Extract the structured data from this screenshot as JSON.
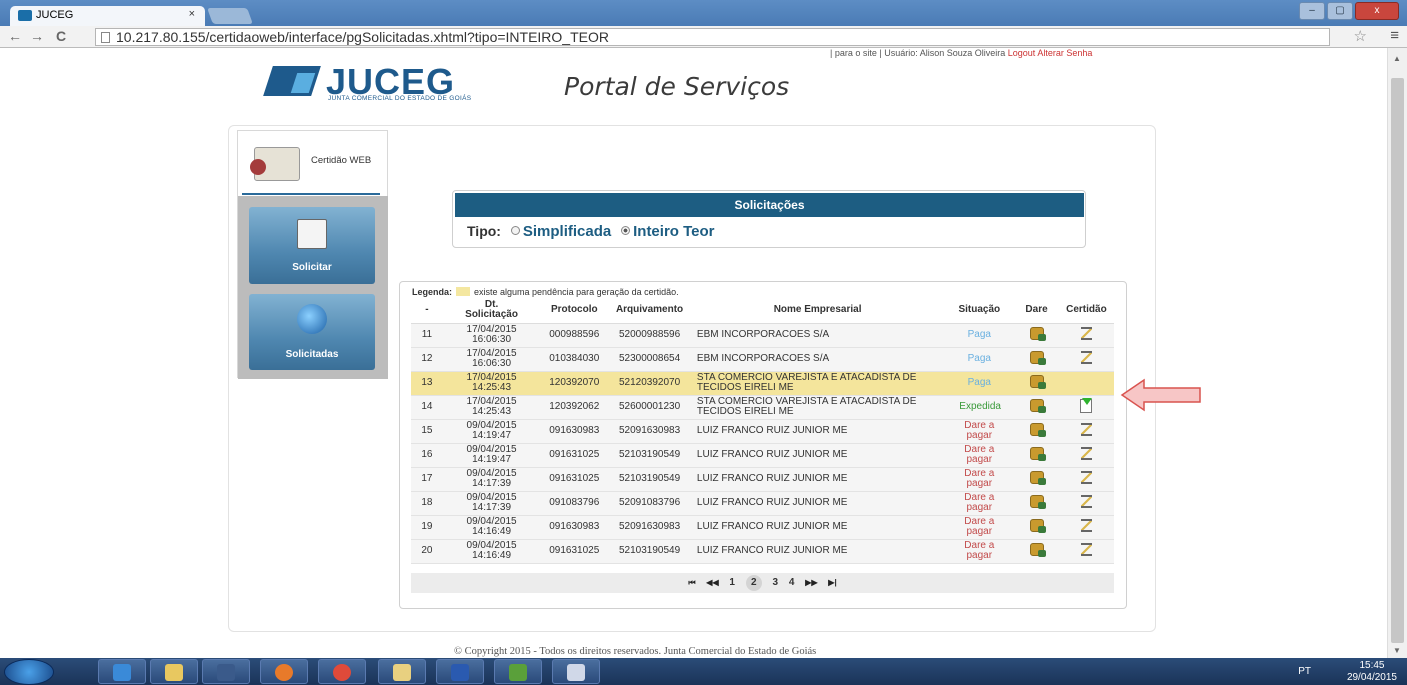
{
  "browser": {
    "tab_title": "JUCEG",
    "tab_close": "×",
    "url": "10.217.80.155/certidaoweb/interface/pgSolicitadas.xhtml?tipo=INTEIRO_TEOR",
    "back": "←",
    "forward": "→",
    "reload": "C",
    "star": "☆",
    "menu": "≡",
    "win_min": "–",
    "win_max": "▢",
    "win_close": "x"
  },
  "header": {
    "top_info": "| para o site | Usuário: Alison Souza Oliveira",
    "logout": "Logout Alterar Senha",
    "logo_word": "JUCEG",
    "logo_sub": "JUNTA COMERCIAL DO ESTADO DE GOIÁS",
    "portal_title": "Portal de Serviços"
  },
  "sidebar": {
    "cert_label": "Certidão WEB",
    "solicitar": "Solicitar",
    "solicitadas": "Solicitadas"
  },
  "solicitacoes": {
    "title": "Solicitações",
    "tipo_label": "Tipo:",
    "opt_simplificada": "Simplificada",
    "opt_inteiro": "Inteiro Teor",
    "selected": "Inteiro Teor"
  },
  "legend": {
    "label": "Legenda:",
    "text": "existe alguma pendência para geração da certidão.",
    "color": "#f4e59c"
  },
  "table": {
    "headers": [
      "-",
      "Dt. Solicitação",
      "Protocolo",
      "Arquivamento",
      "Nome Empresarial",
      "Situação",
      "Dare",
      "Certidão"
    ],
    "rows": [
      {
        "n": "11",
        "date": "17/04/2015",
        "time": "16:06:30",
        "protocolo": "000988596",
        "arquivamento": "52000988596",
        "nome": "EBM INCORPORACOES S/A",
        "situacao": "Paga",
        "status": "paga",
        "certidao": "hourglass",
        "highlight": false
      },
      {
        "n": "12",
        "date": "17/04/2015",
        "time": "16:06:30",
        "protocolo": "010384030",
        "arquivamento": "52300008654",
        "nome": "EBM INCORPORACOES S/A",
        "situacao": "Paga",
        "status": "paga",
        "certidao": "hourglass",
        "highlight": false
      },
      {
        "n": "13",
        "date": "17/04/2015",
        "time": "14:25:43",
        "protocolo": "120392070",
        "arquivamento": "52120392070",
        "nome": "STA COMERCIO VAREJISTA E ATACADISTA DE TECIDOS EIRELI ME",
        "situacao": "Paga",
        "status": "paga",
        "certidao": "none",
        "highlight": true
      },
      {
        "n": "14",
        "date": "17/04/2015",
        "time": "14:25:43",
        "protocolo": "120392062",
        "arquivamento": "52600001230",
        "nome": "STA COMERCIO VAREJISTA E ATACADISTA DE TECIDOS EIRELI ME",
        "situacao": "Expedida",
        "status": "exp",
        "certidao": "download",
        "highlight": false
      },
      {
        "n": "15",
        "date": "09/04/2015",
        "time": "14:19:47",
        "protocolo": "091630983",
        "arquivamento": "52091630983",
        "nome": "LUIZ FRANCO RUIZ JUNIOR ME",
        "situacao": "Dare a pagar",
        "status": "dare",
        "certidao": "hourglass",
        "highlight": false
      },
      {
        "n": "16",
        "date": "09/04/2015",
        "time": "14:19:47",
        "protocolo": "091631025",
        "arquivamento": "52103190549",
        "nome": "LUIZ FRANCO RUIZ JUNIOR ME",
        "situacao": "Dare a pagar",
        "status": "dare",
        "certidao": "hourglass",
        "highlight": false
      },
      {
        "n": "17",
        "date": "09/04/2015",
        "time": "14:17:39",
        "protocolo": "091631025",
        "arquivamento": "52103190549",
        "nome": "LUIZ FRANCO RUIZ JUNIOR ME",
        "situacao": "Dare a pagar",
        "status": "dare",
        "certidao": "hourglass",
        "highlight": false
      },
      {
        "n": "18",
        "date": "09/04/2015",
        "time": "14:17:39",
        "protocolo": "091083796",
        "arquivamento": "52091083796",
        "nome": "LUIZ FRANCO RUIZ JUNIOR ME",
        "situacao": "Dare a pagar",
        "status": "dare",
        "certidao": "hourglass",
        "highlight": false
      },
      {
        "n": "19",
        "date": "09/04/2015",
        "time": "14:16:49",
        "protocolo": "091630983",
        "arquivamento": "52091630983",
        "nome": "LUIZ FRANCO RUIZ JUNIOR ME",
        "situacao": "Dare a pagar",
        "status": "dare",
        "certidao": "hourglass",
        "highlight": false
      },
      {
        "n": "20",
        "date": "09/04/2015",
        "time": "14:16:49",
        "protocolo": "091631025",
        "arquivamento": "52103190549",
        "nome": "LUIZ FRANCO RUIZ JUNIOR ME",
        "situacao": "Dare a pagar",
        "status": "dare",
        "certidao": "hourglass",
        "highlight": false
      }
    ]
  },
  "pager": {
    "first": "⏮",
    "prev": "◀◀",
    "pages": [
      "1",
      "2",
      "3",
      "4"
    ],
    "current": "2",
    "next": "▶▶",
    "last": "▶|"
  },
  "footer": {
    "copyright": "© Copyright 2015 - Todos os direitos reservados. Junta Comercial do Estado de Goiás"
  },
  "taskbar": {
    "lang": "PT",
    "time": "15:45",
    "date": "29/04/2015"
  },
  "colors": {
    "header_blue": "#1d5d82",
    "highlight": "#f4e59c",
    "status_paga": "#6ab0e0",
    "status_expedida": "#3a9a3a",
    "status_dare": "#c24a4a",
    "arrow_fill": "#f7c6c6",
    "arrow_stroke": "#d9534f"
  }
}
